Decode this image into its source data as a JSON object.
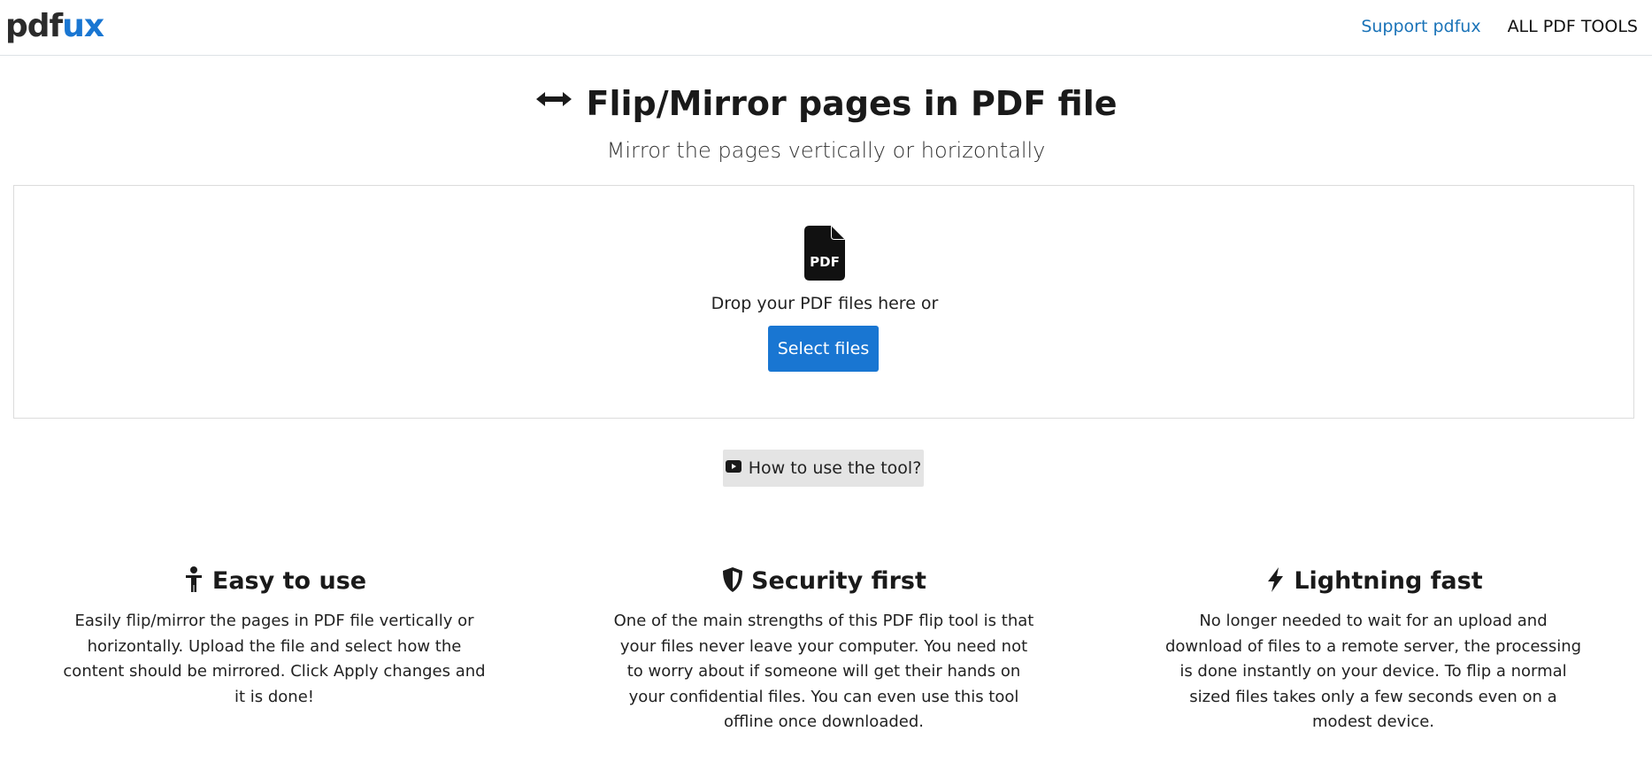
{
  "header": {
    "logo_part1": "pdf",
    "logo_part2": "ux",
    "support_link": "Support pdfux",
    "all_tools_link": "ALL PDF TOOLS"
  },
  "hero": {
    "title": "Flip/Mirror pages in PDF file",
    "subtitle": "Mirror the pages vertically or horizontally"
  },
  "dropzone": {
    "prompt": "Drop your PDF files here or",
    "select_button": "Select files",
    "file_icon_label": "PDF"
  },
  "howto": {
    "label": "How to use the tool?"
  },
  "features": [
    {
      "title": "Easy to use",
      "text": "Easily flip/mirror the pages in PDF file vertically or horizontally. Upload the file and select how the content should be mirrored. Click Apply changes and it is done!"
    },
    {
      "title": "Security first",
      "text": "One of the main strengths of this PDF flip tool is that your files never leave your computer. You need not to worry about if someone will get their hands on your confidential files. You can even use this tool offline once downloaded."
    },
    {
      "title": "Lightning fast",
      "text": "No longer needed to wait for an upload and download of files to a remote server, the processing is done instantly on your device. To flip a normal sized files takes only a few seconds even on a modest device."
    }
  ],
  "colors": {
    "brand_blue": "#1976d2",
    "link_blue": "#1a73b8",
    "howto_bg": "#e4e4e4"
  },
  "icons": {
    "title": "horizontal-arrows-icon",
    "file": "pdf-file-icon",
    "howto": "youtube-icon",
    "feature_1": "child-icon",
    "feature_2": "shield-icon",
    "feature_3": "lightning-icon"
  }
}
